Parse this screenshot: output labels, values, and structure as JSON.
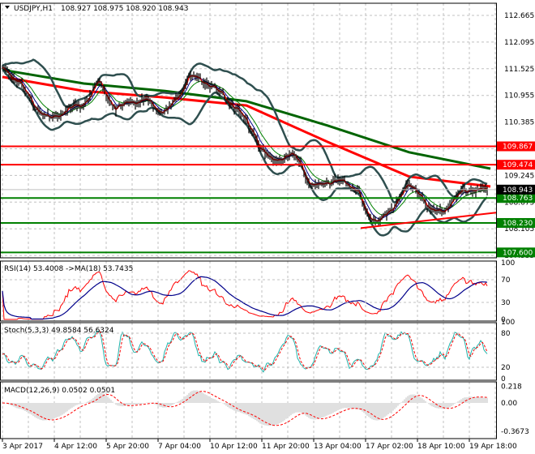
{
  "chart_data": {
    "type": "candlestick-bars",
    "symbol_header": "USDJPY,H1",
    "ohlc_header": "108.927 108.975 108.920 108.943",
    "price_axis_ticks": [
      "112.665",
      "112.095",
      "111.525",
      "110.955",
      "110.385",
      "109.815",
      "109.245",
      "108.675",
      "108.105",
      "107.535"
    ],
    "ylim": [
      107.45,
      112.95
    ],
    "time_axis_ticks": [
      "3 Apr 2017",
      "4 Apr 12:00",
      "5 Apr 20:00",
      "7 Apr 04:00",
      "10 Apr 12:00",
      "11 Apr 20:00",
      "13 Apr 04:00",
      "17 Apr 02:00",
      "18 Apr 10:00",
      "19 Apr 18:00"
    ],
    "close_path": [
      111.5,
      111.4,
      111.26,
      111.0,
      110.74,
      110.58,
      110.43,
      110.55,
      110.66,
      110.72,
      110.78,
      111.0,
      111.26,
      110.95,
      110.66,
      110.75,
      110.83,
      110.83,
      110.83,
      110.7,
      110.57,
      110.75,
      111.0,
      111.35,
      111.32,
      111.25,
      111.15,
      111.0,
      110.85,
      110.66,
      110.45,
      110.22,
      109.8,
      109.62,
      109.62,
      109.64,
      109.68,
      109.5,
      109.01,
      109.05,
      109.1,
      109.1,
      109.1,
      109.05,
      108.92,
      108.45,
      108.3,
      108.35,
      108.45,
      108.75,
      109.01,
      108.95,
      108.8,
      108.49,
      108.45,
      108.55,
      108.75,
      108.9,
      108.97,
      108.91,
      108.943
    ],
    "ma_slow_green": [
      111.5,
      111.21,
      111.05,
      110.83,
      110.31,
      109.74,
      109.39
    ],
    "ma_slow_red": [
      111.35,
      111.05,
      110.91,
      110.74,
      109.96,
      109.22,
      109.01
    ],
    "levels": [
      {
        "price": 109.867,
        "label": "109.867",
        "color": "#ff0000"
      },
      {
        "price": 109.474,
        "label": "109.474",
        "color": "#ff0000"
      },
      {
        "price": 108.763,
        "label": "108.763",
        "color": "#008000"
      },
      {
        "price": 108.23,
        "label": "108.230",
        "color": "#008000"
      },
      {
        "price": 107.6,
        "label": "107.600",
        "color": "#008000"
      }
    ],
    "current_price": {
      "price": 108.943,
      "label": "108.943",
      "color": "#000000"
    },
    "trendline": {
      "from": 108.12,
      "to": 108.45,
      "color": "#ff0000"
    },
    "colors": {
      "bars": "#000000",
      "bollinger": "#2f4f4f",
      "ma_fast_blue": "#00008b",
      "ma_fast_green": "#008000",
      "ma_fast_red": "#ff0000",
      "ma_slow_red": "#ff0000",
      "ma_slow_green": "#006400"
    },
    "rsi": {
      "title": "RSI(14) 53.4008  ->MA(18) 53.7435",
      "ticks": [
        "100",
        "70",
        "30",
        "0"
      ],
      "colors": {
        "rsi": "#ff0000",
        "ma": "#00008b"
      }
    },
    "stoch": {
      "title": "Stoch(5,3,3) 49.8584 56.6324",
      "ticks": [
        "100",
        "80",
        "20",
        "0"
      ],
      "colors": {
        "main": "#20b2aa",
        "signal": "#ff0000"
      }
    },
    "macd": {
      "title": "MACD(12,26,9) 0.0502 0.0501",
      "ticks": [
        "0.218",
        "0.00",
        "-0.3673"
      ],
      "colors": {
        "hist": "#c0c0c0",
        "signal": "#ff0000"
      }
    }
  }
}
